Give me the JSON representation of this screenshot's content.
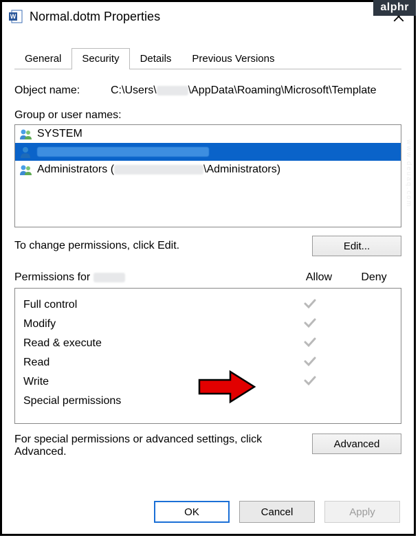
{
  "badge": "alphr",
  "window": {
    "title": "Normal.dotm Properties"
  },
  "tabs": [
    {
      "label": "General",
      "active": false
    },
    {
      "label": "Security",
      "active": true
    },
    {
      "label": "Details",
      "active": false
    },
    {
      "label": "Previous Versions",
      "active": false
    }
  ],
  "object": {
    "label": "Object name:",
    "path_pre": "C:\\Users\\",
    "path_post": "\\AppData\\Roaming\\Microsoft\\Template"
  },
  "group_label": "Group or user names:",
  "principals": [
    {
      "name": "SYSTEM",
      "icon": "group",
      "selected": false
    },
    {
      "name": "",
      "icon": "user",
      "selected": true,
      "redacted": true
    },
    {
      "name_pre": "Administrators (",
      "name_post": "\\Administrators)",
      "icon": "group",
      "selected": false,
      "redacted_mid": true
    }
  ],
  "edit_hint": "To change permissions, click Edit.",
  "edit_btn": "Edit...",
  "perm_label_pre": "Permissions for ",
  "perm_cols": {
    "allow": "Allow",
    "deny": "Deny"
  },
  "permissions": [
    {
      "name": "Full control",
      "allow": true,
      "deny": false
    },
    {
      "name": "Modify",
      "allow": true,
      "deny": false
    },
    {
      "name": "Read & execute",
      "allow": true,
      "deny": false
    },
    {
      "name": "Read",
      "allow": true,
      "deny": false
    },
    {
      "name": "Write",
      "allow": true,
      "deny": false
    },
    {
      "name": "Special permissions",
      "allow": false,
      "deny": false
    }
  ],
  "adv_hint": "For special permissions or advanced settings, click Advanced.",
  "adv_btn": "Advanced",
  "buttons": {
    "ok": "OK",
    "cancel": "Cancel",
    "apply": "Apply"
  },
  "watermark": "www.deuaq.com"
}
